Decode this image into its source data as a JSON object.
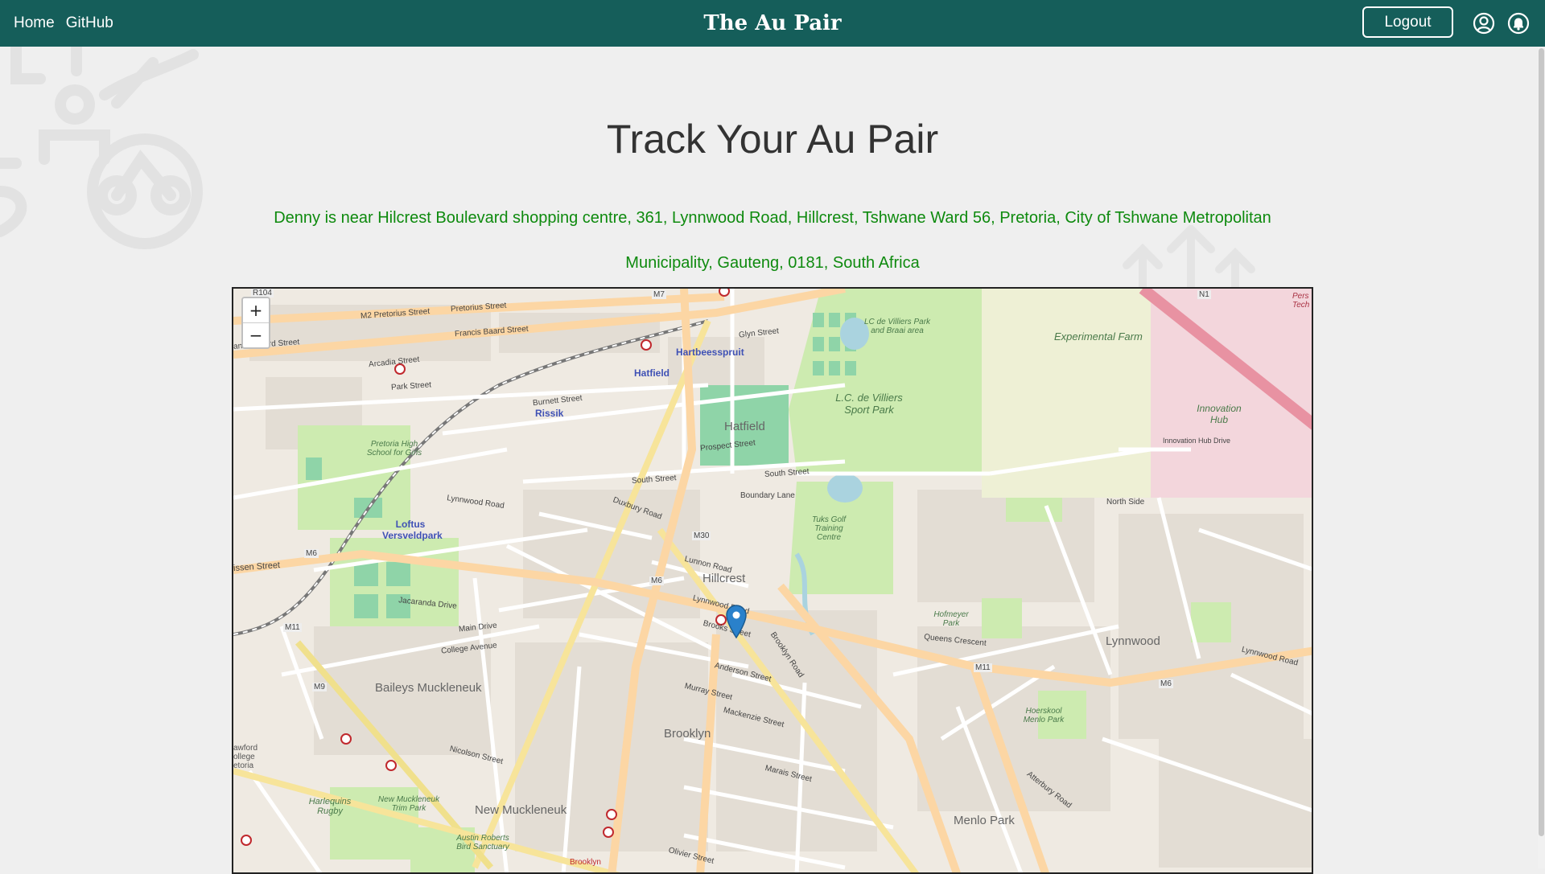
{
  "nav": {
    "links": [
      {
        "label": "Home"
      },
      {
        "label": "GitHub"
      }
    ],
    "brand": "The Au Pair",
    "logout_label": "Logout",
    "profile_icon": "user-circle-icon",
    "bell_icon": "bell-icon",
    "bg_color": "#155e5a"
  },
  "main": {
    "title": "Track Your Au Pair",
    "location_text": "Denny is near Hilcrest Boulevard shopping centre, 361, Lynnwood Road, Hillcrest, Tshwane Ward 56, Pretoria, City of Tshwane Metropolitan Municipality, Gauteng, 0181, South Africa",
    "location_color": "#0e8a0e"
  },
  "map": {
    "zoom_in_label": "+",
    "zoom_out_label": "−",
    "marker_icon": "map-pin-icon",
    "labels": {
      "experimental_farm": "Experimental Farm",
      "lc_de_villiers": "L.C. de Villiers Sport Park",
      "lc_braai": "LC de Villiers Park and Braai area",
      "innovation_hub": "Innovation Hub",
      "hatfield": "Hatfield",
      "hatfield_station": "Hatfield",
      "hartbeesspruit": "Hartbeesspruit",
      "rissik": "Rissik",
      "loftus": "Loftus Versveldpark",
      "pretoria_high": "Pretoria High School for Girls",
      "tuks_golf": "Tuks Golf Training Centre",
      "hillcrest": "Hillcrest",
      "hofmeyer": "Hofmeyer Park",
      "lynnwood": "Lynnwood",
      "hoerskool": "Hoerskool Menlo Park",
      "baileys": "Baileys Muckleneuk",
      "brooklyn": "Brooklyn",
      "new_muckleneuk": "New Muckleneuk",
      "new_muckleneuk_park": "New Muckleneuk Trim Park",
      "harlequins": "Harlequins Rugby",
      "austin_roberts": "Austin Roberts Bird Sanctuary",
      "menlo_park": "Menlo Park",
      "brooklyn_bottom": "Brooklyn",
      "pers_tech": "Pers Tech",
      "awford": "awford ollege etoria",
      "pretorius_street": "Pretorius Street",
      "m2_pretorius": "M2 Pretorius Street",
      "francis_baard": "Francis Baard Street",
      "francis_baard_left": "ancis Baard Street",
      "park_street": "Park Street",
      "burnett_street": "Burnett Street",
      "south_street": "South Street",
      "lynnwood_road": "Lynnwood Road",
      "lynnwood_road_east": "Lynnwood Road",
      "lynnwood_road_far": "Lynnwood Road",
      "brooks_street": "Brooks Street",
      "anderson_street": "Anderson Street",
      "atterbury_road": "Atterbury Road",
      "brooklyn_road": "Brooklyn Road",
      "queens_crescent": "Queens Crescent",
      "boundary_lane": "Boundary Lane",
      "south_street_east": "South Street",
      "north_side": "North Side",
      "innovation_hub_drive": "Innovation Hub Drive",
      "prospect_street": "Prospect Street",
      "duxbury_road": "Duxbury Road",
      "lunnon_road": "Lunnon Road",
      "jacaranda_drive": "Jacaranda Drive",
      "main_drive": "Main Drive",
      "college_avenue": "College Avenue",
      "murray_street": "Murray Street",
      "mackenzie_street": "Mackenzie Street",
      "nicolson_street": "Nicolson Street",
      "marais_street": "Marais Street",
      "olivier_street": "Olivier Street",
      "m6": "M6",
      "m6b": "M6",
      "m6c": "M6",
      "m7": "M7",
      "m9": "M9",
      "m11": "M11",
      "m11b": "M11",
      "m30": "M30",
      "n1": "N1",
      "r104": "R104",
      "issen_street": "issen Street",
      "glyn_street": "Glyn Street",
      "arcadia_street": "Arcadia Street"
    }
  }
}
